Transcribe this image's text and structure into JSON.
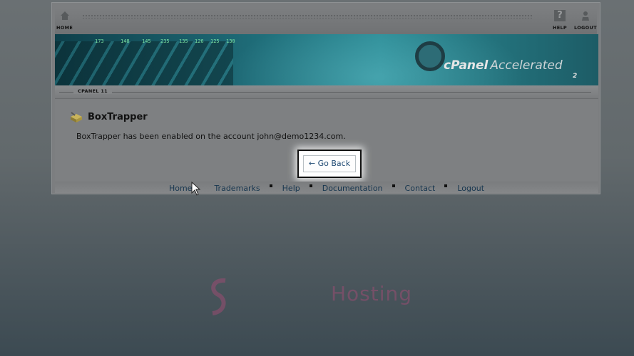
{
  "header": {
    "home_label": "HOME",
    "help_label": "HELP",
    "logout_label": "LOGOUT",
    "help_glyph": "?"
  },
  "banner": {
    "brand": "cPanel",
    "product": "Accelerated",
    "version": "2",
    "led_values": [
      "173",
      "148",
      "145",
      "235",
      "135",
      "126",
      "125",
      "130"
    ]
  },
  "breadcrumb": {
    "label": "CPANEL 11"
  },
  "page": {
    "title": "BoxTrapper",
    "message": "BoxTrapper has been enabled on the account john@demo1234.com.",
    "go_back_label": "← Go Back"
  },
  "footer": {
    "links": [
      "Home",
      "Trademarks",
      "Help",
      "Documentation",
      "Contact",
      "Logout"
    ]
  },
  "watermark": {
    "text": "Hosting"
  },
  "colors": {
    "background_top": "#6a7073",
    "background_bottom": "#3c4a52",
    "link": "#17364f",
    "highlight_border": "#111111"
  }
}
